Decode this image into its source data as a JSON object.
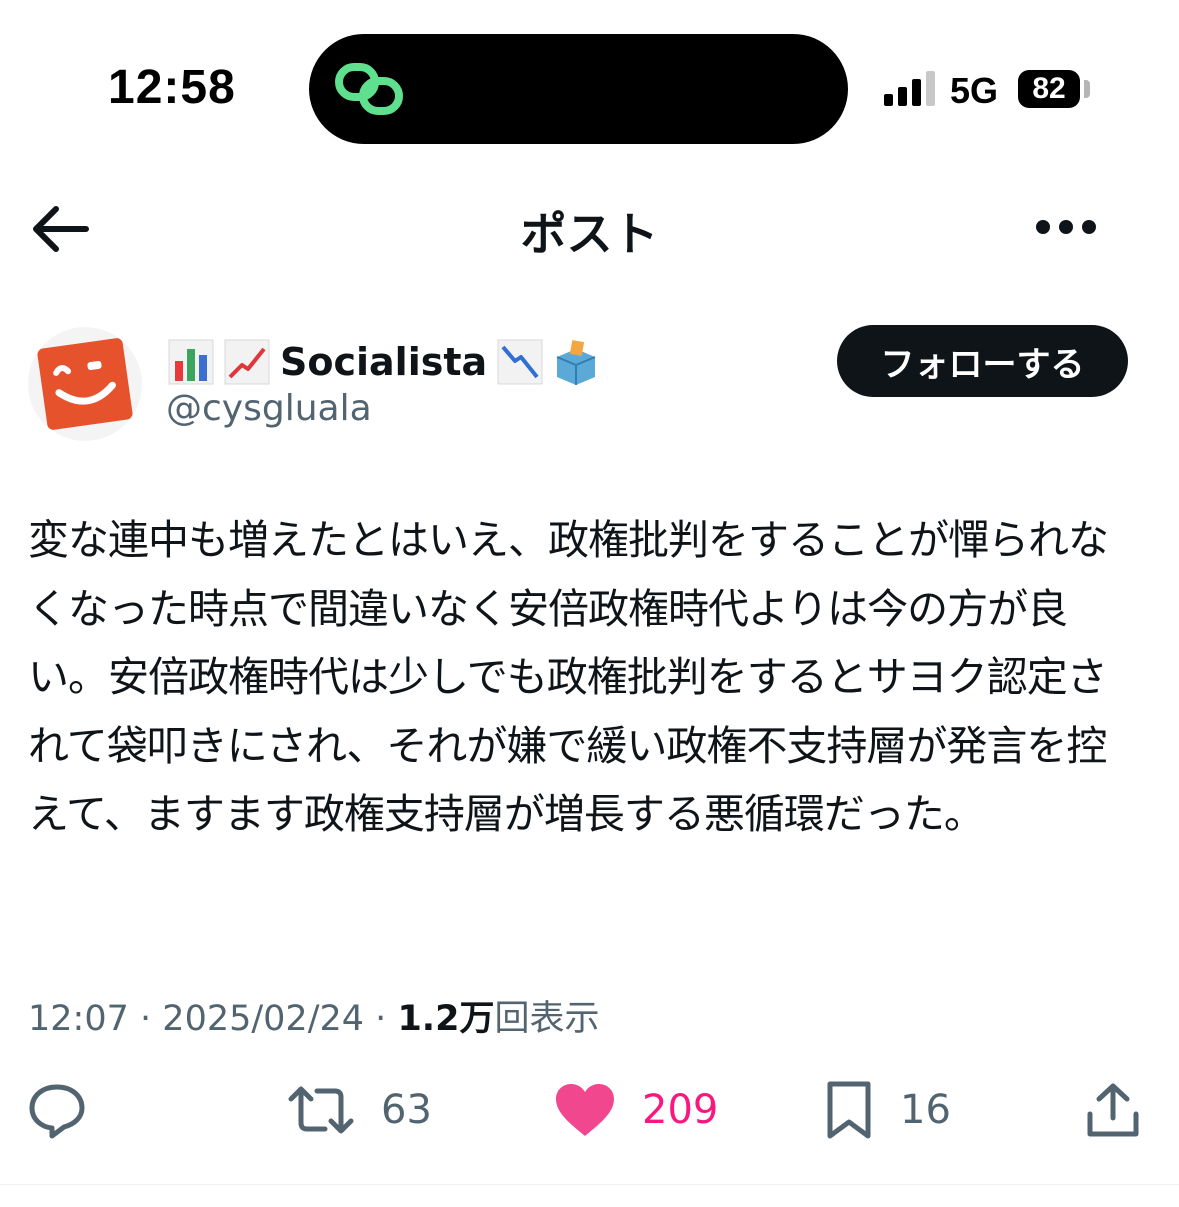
{
  "status_bar": {
    "time": "12:58",
    "network": "5G",
    "battery": "82"
  },
  "header": {
    "title": "ポスト"
  },
  "author": {
    "display_name": "Socialista",
    "handle": "@cysgluala",
    "follow_label": "フォローする",
    "name_emojis": [
      "bar-chart-emoji",
      "chart-increasing-emoji",
      "chart-decreasing-emoji",
      "ballot-box-emoji"
    ]
  },
  "post": {
    "text": "変な連中も増えたとはいえ、政権批判をすることが憚られなくなった時点で間違いなく安倍政権時代よりは今の方が良い。安倍政権時代は少しでも政権批判をするとサヨク認定されて袋叩きにされ、それが嫌で緩い政権不支持層が発言を控えて、ますます政権支持層が増長する悪循環だった。",
    "time": "12:07",
    "date": "2025/02/24",
    "views_count": "1.2万",
    "views_label": "回表示",
    "separator": "·"
  },
  "actions": {
    "retweets": "63",
    "likes": "209",
    "bookmarks": "16"
  },
  "colors": {
    "text": "#0f1419",
    "secondary": "#536471",
    "like": "#f91880",
    "avatar": "#e6522c"
  }
}
